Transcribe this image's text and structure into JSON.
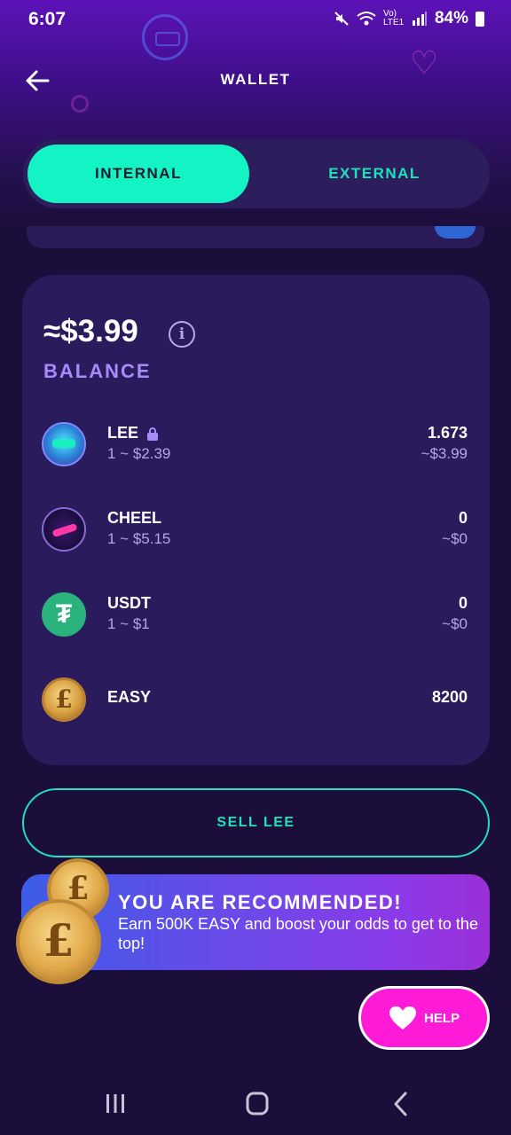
{
  "status_bar": {
    "time": "6:07",
    "network": "Vo) LTE1",
    "battery": "84%"
  },
  "header": {
    "title": "WALLET"
  },
  "tabs": [
    {
      "label": "INTERNAL",
      "active": true
    },
    {
      "label": "EXTERNAL",
      "active": false
    }
  ],
  "balance": {
    "amount": "≈$3.99",
    "label": "BALANCE",
    "tokens": [
      {
        "name": "LEE",
        "rate": "1 ~ $2.39",
        "amount": "1.673",
        "usd": "~$3.99",
        "icon": "lee-glasses-icon",
        "locked": true
      },
      {
        "name": "CHEEL",
        "rate": "1 ~ $5.15",
        "amount": "0",
        "usd": "~$0",
        "icon": "cheel-icon"
      },
      {
        "name": "USDT",
        "rate": "1 ~ $1",
        "amount": "0",
        "usd": "~$0",
        "icon": "tether-icon"
      },
      {
        "name": "EASY",
        "amount": "8200",
        "icon": "easy-coin-icon"
      }
    ]
  },
  "sell_button": {
    "label": "SELL LEE"
  },
  "banner": {
    "title": "YOU ARE RECOMMENDED!",
    "text": "Earn 500K EASY and boost your odds to get to the top!"
  },
  "help_button": {
    "label": "HELP"
  },
  "colors": {
    "accent": "#14f3c3",
    "card": "#2a1b5c",
    "balance_label": "#a78bfa",
    "help": "#ff1ad8"
  }
}
